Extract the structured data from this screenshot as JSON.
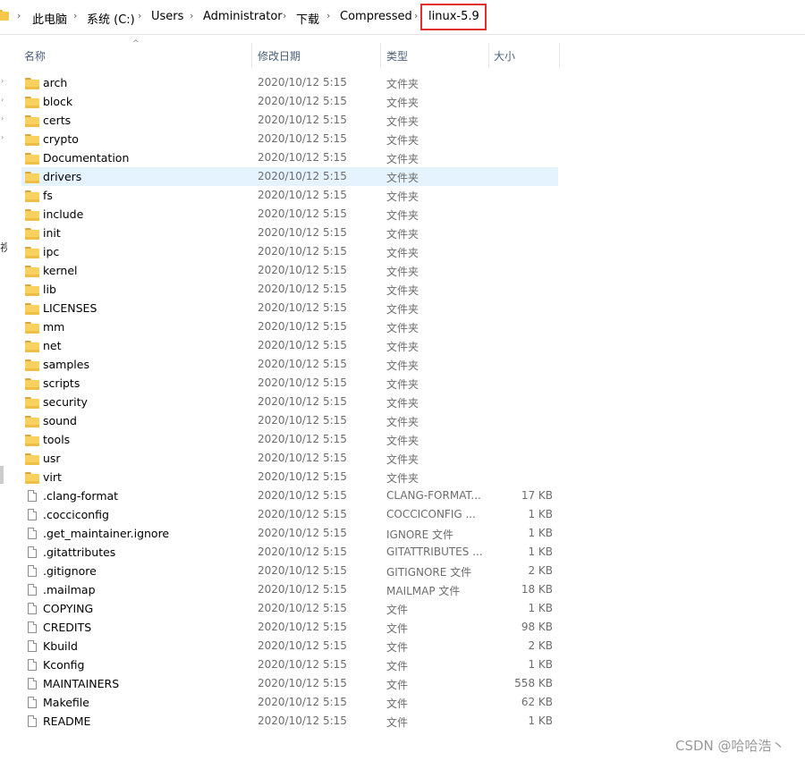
{
  "breadcrumb": {
    "items": [
      "此电脑",
      "系统 (C:)",
      "Users",
      "Administrator",
      "下载",
      "Compressed",
      "linux-5.9"
    ],
    "separator": "›",
    "highlight_color": "#e0312d"
  },
  "columns": {
    "name": "名称",
    "date": "修改日期",
    "type": "类型",
    "size": "大小"
  },
  "nav_pane": {
    "partial_label": "视"
  },
  "files": [
    {
      "name": "arch",
      "date": "2020/10/12 5:15",
      "type": "文件夹",
      "size": "",
      "kind": "folder"
    },
    {
      "name": "block",
      "date": "2020/10/12 5:15",
      "type": "文件夹",
      "size": "",
      "kind": "folder"
    },
    {
      "name": "certs",
      "date": "2020/10/12 5:15",
      "type": "文件夹",
      "size": "",
      "kind": "folder"
    },
    {
      "name": "crypto",
      "date": "2020/10/12 5:15",
      "type": "文件夹",
      "size": "",
      "kind": "folder"
    },
    {
      "name": "Documentation",
      "date": "2020/10/12 5:15",
      "type": "文件夹",
      "size": "",
      "kind": "folder"
    },
    {
      "name": "drivers",
      "date": "2020/10/12 5:15",
      "type": "文件夹",
      "size": "",
      "kind": "folder",
      "selected": true
    },
    {
      "name": "fs",
      "date": "2020/10/12 5:15",
      "type": "文件夹",
      "size": "",
      "kind": "folder"
    },
    {
      "name": "include",
      "date": "2020/10/12 5:15",
      "type": "文件夹",
      "size": "",
      "kind": "folder"
    },
    {
      "name": "init",
      "date": "2020/10/12 5:15",
      "type": "文件夹",
      "size": "",
      "kind": "folder"
    },
    {
      "name": "ipc",
      "date": "2020/10/12 5:15",
      "type": "文件夹",
      "size": "",
      "kind": "folder"
    },
    {
      "name": "kernel",
      "date": "2020/10/12 5:15",
      "type": "文件夹",
      "size": "",
      "kind": "folder"
    },
    {
      "name": "lib",
      "date": "2020/10/12 5:15",
      "type": "文件夹",
      "size": "",
      "kind": "folder"
    },
    {
      "name": "LICENSES",
      "date": "2020/10/12 5:15",
      "type": "文件夹",
      "size": "",
      "kind": "folder"
    },
    {
      "name": "mm",
      "date": "2020/10/12 5:15",
      "type": "文件夹",
      "size": "",
      "kind": "folder"
    },
    {
      "name": "net",
      "date": "2020/10/12 5:15",
      "type": "文件夹",
      "size": "",
      "kind": "folder"
    },
    {
      "name": "samples",
      "date": "2020/10/12 5:15",
      "type": "文件夹",
      "size": "",
      "kind": "folder"
    },
    {
      "name": "scripts",
      "date": "2020/10/12 5:15",
      "type": "文件夹",
      "size": "",
      "kind": "folder"
    },
    {
      "name": "security",
      "date": "2020/10/12 5:15",
      "type": "文件夹",
      "size": "",
      "kind": "folder"
    },
    {
      "name": "sound",
      "date": "2020/10/12 5:15",
      "type": "文件夹",
      "size": "",
      "kind": "folder"
    },
    {
      "name": "tools",
      "date": "2020/10/12 5:15",
      "type": "文件夹",
      "size": "",
      "kind": "folder"
    },
    {
      "name": "usr",
      "date": "2020/10/12 5:15",
      "type": "文件夹",
      "size": "",
      "kind": "folder"
    },
    {
      "name": "virt",
      "date": "2020/10/12 5:15",
      "type": "文件夹",
      "size": "",
      "kind": "folder"
    },
    {
      "name": ".clang-format",
      "date": "2020/10/12 5:15",
      "type": "CLANG-FORMAT...",
      "size": "17 KB",
      "kind": "file"
    },
    {
      "name": ".cocciconfig",
      "date": "2020/10/12 5:15",
      "type": "COCCICONFIG ...",
      "size": "1 KB",
      "kind": "file"
    },
    {
      "name": ".get_maintainer.ignore",
      "date": "2020/10/12 5:15",
      "type": "IGNORE 文件",
      "size": "1 KB",
      "kind": "file"
    },
    {
      "name": ".gitattributes",
      "date": "2020/10/12 5:15",
      "type": "GITATTRIBUTES ...",
      "size": "1 KB",
      "kind": "file"
    },
    {
      "name": ".gitignore",
      "date": "2020/10/12 5:15",
      "type": "GITIGNORE 文件",
      "size": "2 KB",
      "kind": "file"
    },
    {
      "name": ".mailmap",
      "date": "2020/10/12 5:15",
      "type": "MAILMAP 文件",
      "size": "18 KB",
      "kind": "file"
    },
    {
      "name": "COPYING",
      "date": "2020/10/12 5:15",
      "type": "文件",
      "size": "1 KB",
      "kind": "file"
    },
    {
      "name": "CREDITS",
      "date": "2020/10/12 5:15",
      "type": "文件",
      "size": "98 KB",
      "kind": "file"
    },
    {
      "name": "Kbuild",
      "date": "2020/10/12 5:15",
      "type": "文件",
      "size": "2 KB",
      "kind": "file"
    },
    {
      "name": "Kconfig",
      "date": "2020/10/12 5:15",
      "type": "文件",
      "size": "1 KB",
      "kind": "file"
    },
    {
      "name": "MAINTAINERS",
      "date": "2020/10/12 5:15",
      "type": "文件",
      "size": "558 KB",
      "kind": "file"
    },
    {
      "name": "Makefile",
      "date": "2020/10/12 5:15",
      "type": "文件",
      "size": "62 KB",
      "kind": "file"
    },
    {
      "name": "README",
      "date": "2020/10/12 5:15",
      "type": "文件",
      "size": "1 KB",
      "kind": "file"
    }
  ],
  "watermark": "CSDN @哈哈浩丶"
}
